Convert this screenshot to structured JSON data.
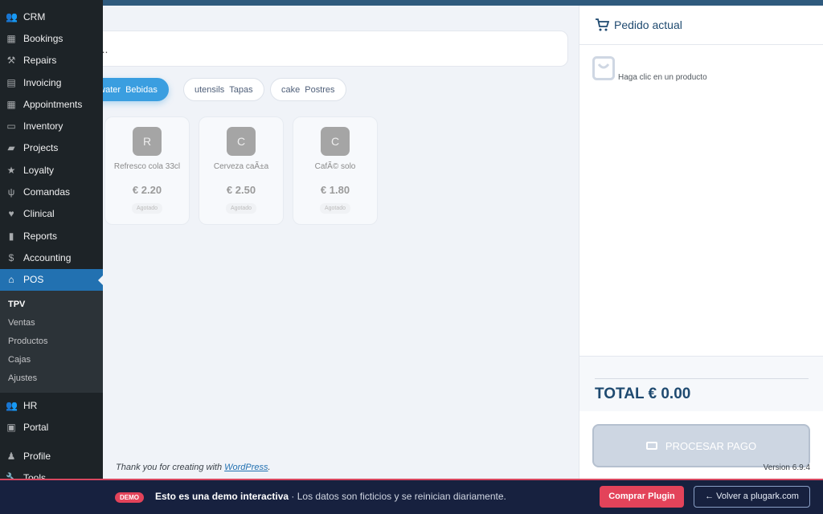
{
  "sidebar": {
    "items": [
      {
        "label": "CRM",
        "icon": "groups-icon",
        "glyph": "👥"
      },
      {
        "label": "Bookings",
        "icon": "calendar-icon",
        "glyph": "▦"
      },
      {
        "label": "Repairs",
        "icon": "hammer-icon",
        "glyph": "⚒"
      },
      {
        "label": "Invoicing",
        "icon": "document-icon",
        "glyph": "▤"
      },
      {
        "label": "Appointments",
        "icon": "calendar-icon",
        "glyph": "▦"
      },
      {
        "label": "Inventory",
        "icon": "archive-icon",
        "glyph": "▭"
      },
      {
        "label": "Projects",
        "icon": "folder-icon",
        "glyph": "▰"
      },
      {
        "label": "Loyalty",
        "icon": "star-icon",
        "glyph": "★"
      },
      {
        "label": "Comandas",
        "icon": "utensils-icon",
        "glyph": "ψ"
      },
      {
        "label": "Clinical",
        "icon": "heart-icon",
        "glyph": "♥"
      },
      {
        "label": "Reports",
        "icon": "chart-bar-icon",
        "glyph": "▮"
      },
      {
        "label": "Accounting",
        "icon": "dollar-icon",
        "glyph": "$"
      },
      {
        "label": "POS",
        "icon": "store-icon",
        "glyph": "⌂"
      }
    ],
    "submenu": [
      "TPV",
      "Ventas",
      "Productos",
      "Cajas",
      "Ajustes"
    ],
    "items2": [
      {
        "label": "HR",
        "icon": "groups-icon",
        "glyph": "👥"
      },
      {
        "label": "Portal",
        "icon": "id-card-icon",
        "glyph": "▣"
      }
    ],
    "items3": [
      {
        "label": "Profile",
        "icon": "user-icon",
        "glyph": "♟"
      },
      {
        "label": "Tools",
        "icon": "wrench-icon",
        "glyph": "🔧"
      }
    ]
  },
  "search": {
    "value": "to..."
  },
  "categories": [
    {
      "icon": "s-water",
      "label": "Bebidas"
    },
    {
      "icon": "utensils",
      "label": "Tapas"
    },
    {
      "icon": "cake",
      "label": "Postres"
    }
  ],
  "products": [
    {
      "initial": "R",
      "name": "Refresco cola 33cl",
      "price": "€ 2.20",
      "status": "Agotado"
    },
    {
      "initial": "C",
      "name": "Cerveza caÃ±a",
      "price": "€ 2.50",
      "status": "Agotado"
    },
    {
      "initial": "C",
      "name": "CafÃ© solo",
      "price": "€ 1.80",
      "status": "Agotado"
    }
  ],
  "order": {
    "title": "Pedido actual",
    "empty": "Haga clic en un producto",
    "total": "TOTAL € 0.00",
    "pay": "PROCESAR PAGO"
  },
  "footer": {
    "text": "Thank you for creating with ",
    "link": "WordPress",
    "version": "Version 6.9.4"
  },
  "banner": {
    "badge": "DEMO",
    "title": "Esto es una demo interactiva",
    "sep": " · ",
    "text": "Los datos son ficticios y se reinician diariamente.",
    "buy": "Comprar Plugin",
    "back": "← Volver a plugark.com"
  }
}
